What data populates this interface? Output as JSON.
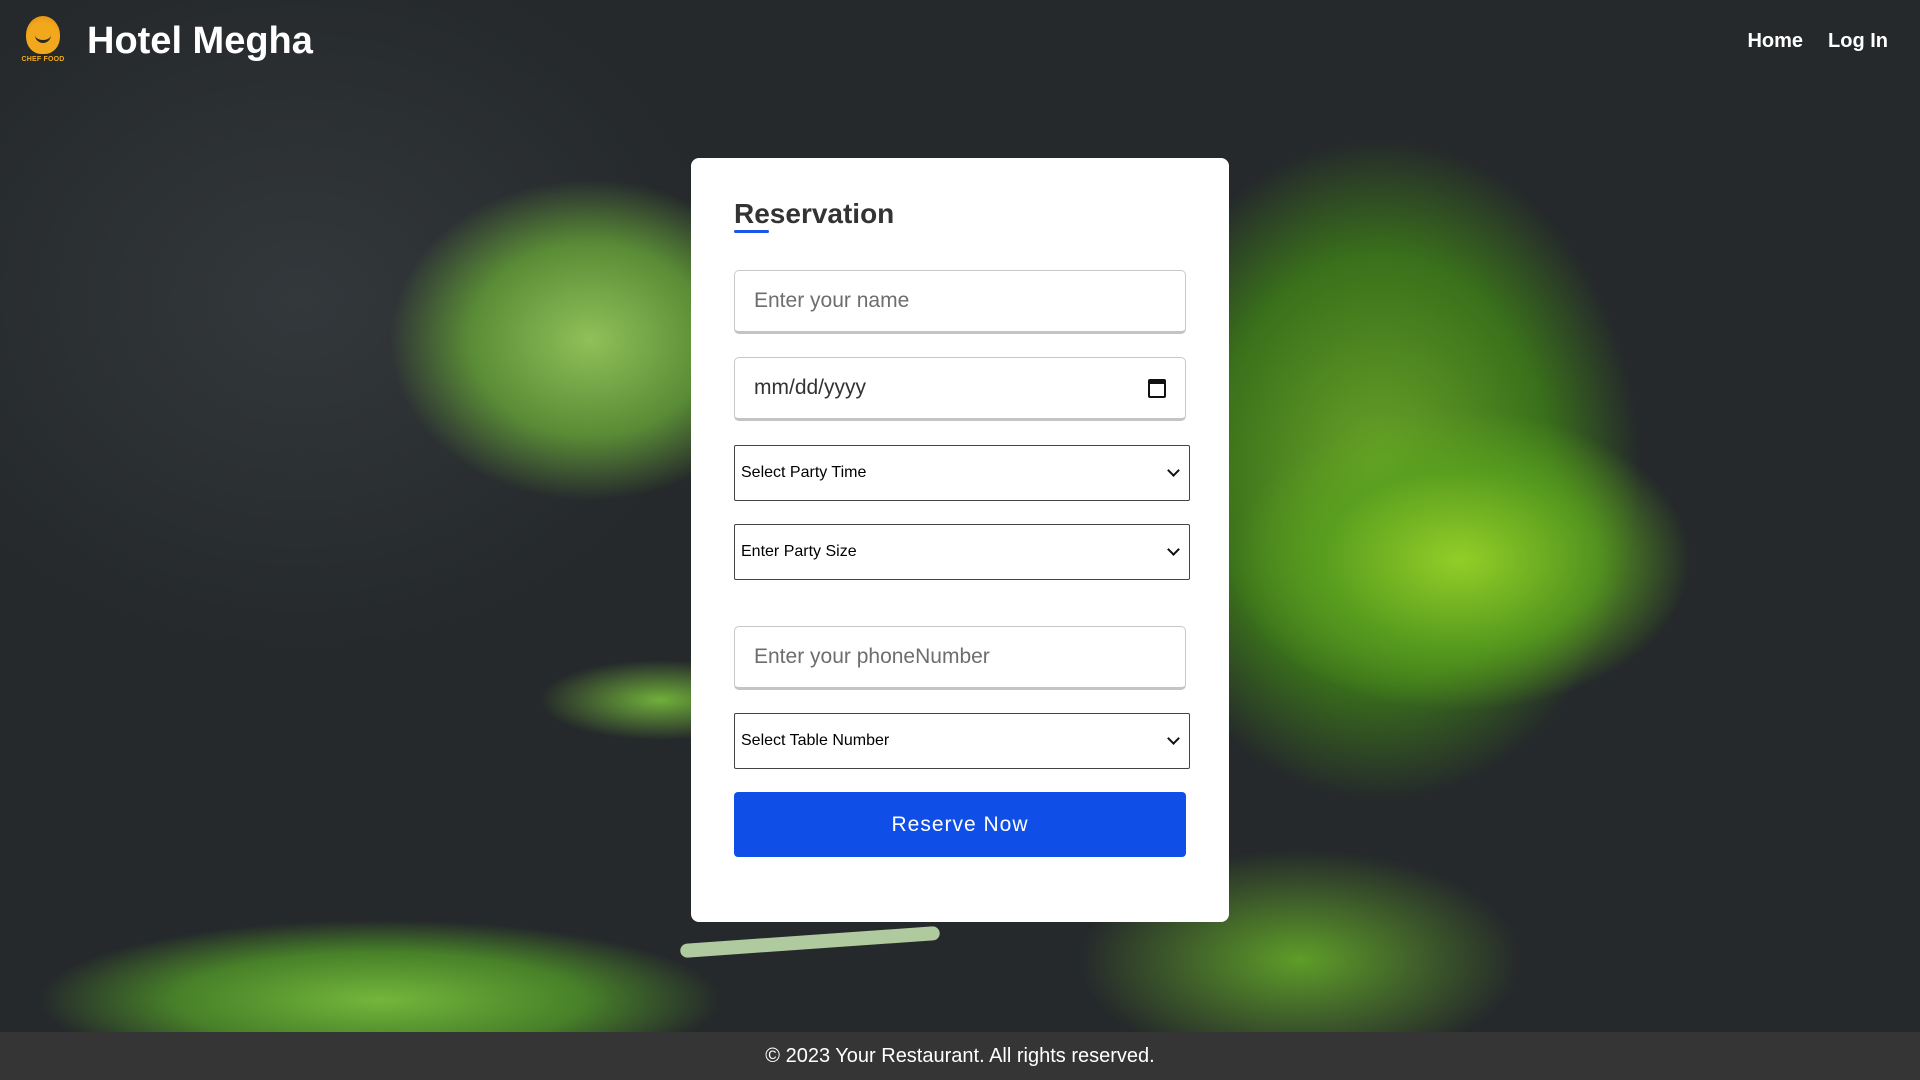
{
  "header": {
    "logo_text": "CHEF FOOD",
    "brand": "Hotel Megha",
    "nav": [
      {
        "label": "Home"
      },
      {
        "label": "Log In"
      }
    ]
  },
  "form": {
    "title": "Reservation",
    "name_placeholder": "Enter your name",
    "date_placeholder": "mm/dd/yyyy",
    "party_time_select": "Select Party Time",
    "party_size_select": "Enter Party Size",
    "phone_placeholder": "Enter your phoneNumber",
    "table_select": "Select Table Number",
    "submit_label": "Reserve Now"
  },
  "footer": {
    "text": "© 2023 Your Restaurant. All rights reserved."
  },
  "colors": {
    "accent": "#0f4fe8",
    "footer_bg": "#353535",
    "logo": "#f2a81d"
  },
  "icons": {
    "logo": "chef-bird-logo-icon",
    "calendar": "calendar-icon",
    "dropdown": "chevron-down-icon"
  }
}
